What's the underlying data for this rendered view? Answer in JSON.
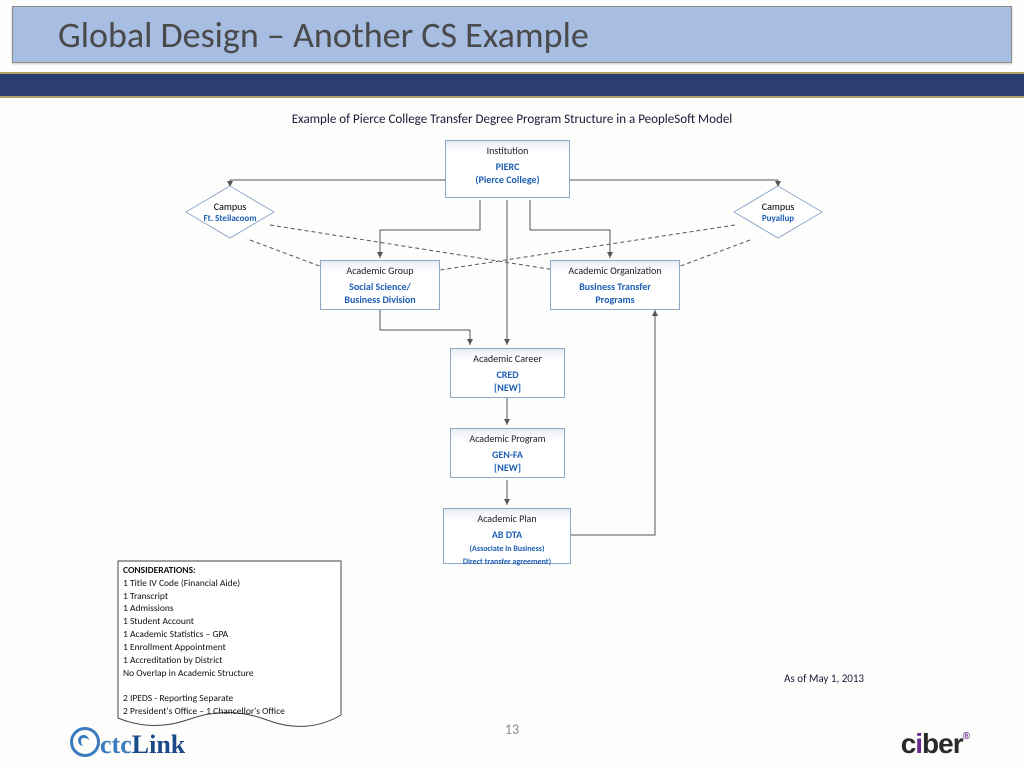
{
  "title": "Global Design – Another CS Example",
  "subtitle": "Example of Pierce College Transfer Degree Program Structure in a PeopleSoft Model",
  "date": "As of May 1, 2013",
  "page": "13",
  "left_logo": "ctcLink",
  "right_logo_main": "c",
  "right_logo_dot": "i",
  "right_logo_end": "ber",
  "boxes": {
    "institution": {
      "label": "Institution",
      "value1": "PIERC",
      "value2": "(Pierce College)"
    },
    "campus_left": {
      "label": "Campus",
      "value": "Ft. Steilacoom"
    },
    "campus_right": {
      "label": "Campus",
      "value": "Puyallup"
    },
    "group": {
      "label": "Academic Group",
      "value1": "Social Science/",
      "value2": "Business Division"
    },
    "org": {
      "label": "Academic Organization",
      "value1": "Business Transfer",
      "value2": "Programs"
    },
    "career": {
      "label": "Academic Career",
      "value1": "CRED",
      "value2": "[NEW]"
    },
    "program": {
      "label": "Academic Program",
      "value1": "GEN-FA",
      "value2": "[NEW]"
    },
    "plan": {
      "label": "Academic Plan",
      "value1": "AB DTA",
      "value2": "(Associate in Business)",
      "value3": "Direct transfer agreement)"
    }
  },
  "notes": {
    "heading": "CONSIDERATIONS:",
    "items": [
      "1 Title IV Code (Financial Aide)",
      "1 Transcript",
      "1 Admissions",
      "1 Student Account",
      "1 Academic Statistics – GPA",
      "1 Enrollment Appointment",
      "1 Accreditation by District",
      "No Overlap in Academic Structure",
      "",
      "2 IPEDS  - Reporting Separate",
      "2 President's Office – 1 Chancellor's Office"
    ]
  }
}
